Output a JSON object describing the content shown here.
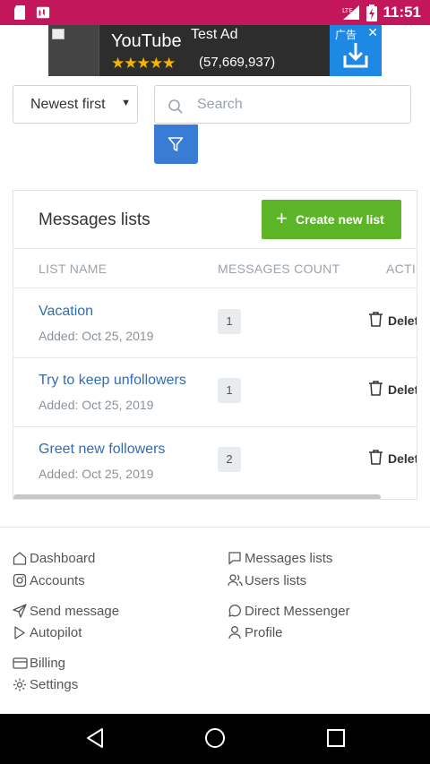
{
  "status_bar": {
    "time": "11:51",
    "network_label": "LTE"
  },
  "ad": {
    "title": "YouTube",
    "label": "Test Ad",
    "stars": "★★★★★",
    "rating_count": "(57,669,937)",
    "tag": "广告",
    "close": "✕"
  },
  "controls": {
    "sort_value": "Newest first",
    "search_placeholder": "Search"
  },
  "card": {
    "title": "Messages lists",
    "create_button": "Create new list",
    "columns": [
      "LIST NAME",
      "MESSAGES COUNT",
      "ACTIONS"
    ],
    "rows": [
      {
        "name": "Vacation",
        "added": "Added: Oct 25, 2019",
        "count": "1",
        "action": "Delete"
      },
      {
        "name": "Try to keep unfollowers",
        "added": "Added: Oct 25, 2019",
        "count": "1",
        "action": "Delete"
      },
      {
        "name": "Greet new followers",
        "added": "Added: Oct 25, 2019",
        "count": "2",
        "action": "Delete"
      }
    ]
  },
  "footer": {
    "dashboard": "Dashboard",
    "messages_lists": "Messages lists",
    "accounts": "Accounts",
    "users_lists": "Users lists",
    "send_message": "Send message",
    "direct_messenger": "Direct Messenger",
    "autopilot": "Autopilot",
    "profile": "Profile",
    "billing": "Billing",
    "settings": "Settings"
  },
  "colors": {
    "status_bar": "#c2185b",
    "primary_blue": "#3a7bd5",
    "create_green": "#5cb527",
    "link_blue": "#2f6db5"
  }
}
